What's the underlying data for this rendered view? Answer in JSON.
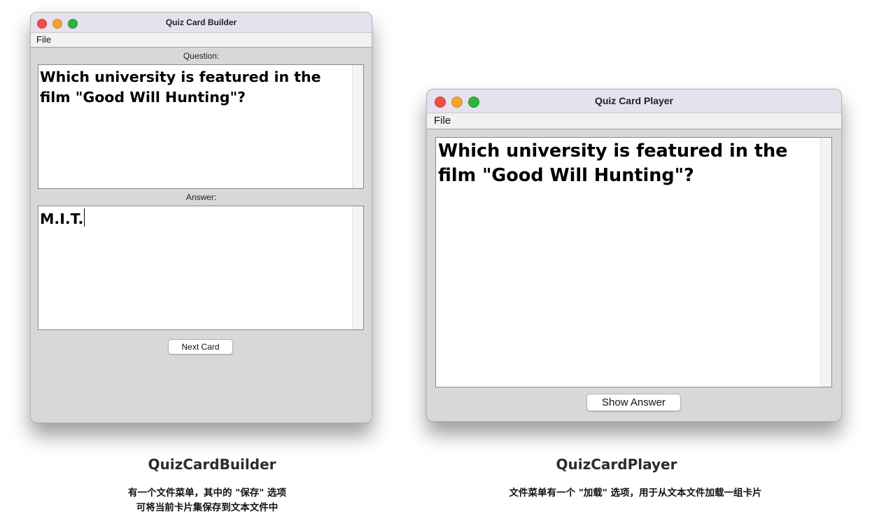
{
  "builder": {
    "title": "Quiz Card Builder",
    "menu": [
      "File"
    ],
    "question_label": "Question:",
    "question_text": "Which university is featured in the\nfilm \"Good Will Hunting\"?",
    "answer_label": "Answer:",
    "answer_text": "M.I.T.",
    "next_button": "Next Card"
  },
  "player": {
    "title": "Quiz Card Player",
    "menu": [
      "File"
    ],
    "card_text": "Which university is featured in the\nfilm \"Good Will Hunting\"?",
    "show_button": "Show Answer"
  },
  "captions": {
    "builder_title": "QuizCardBuilder",
    "builder_desc_line1": "有一个文件菜单，其中的 \"保存\" 选项",
    "builder_desc_line2": "可将当前卡片集保存到文本文件中",
    "player_title": "QuizCardPlayer",
    "player_desc": "文件菜单有一个 \"加载\" 选项，用于从文本文件加载一组卡片"
  }
}
